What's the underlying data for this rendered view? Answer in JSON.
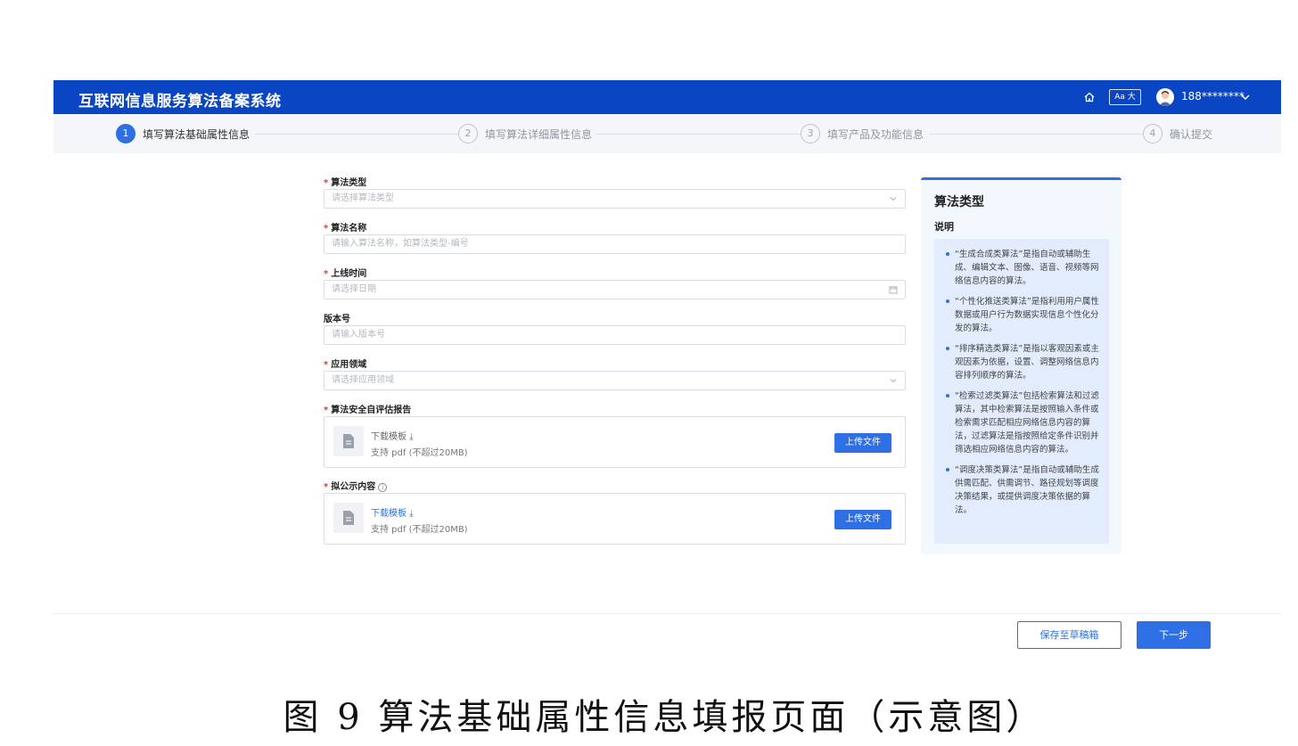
{
  "header": {
    "title": "互联网信息服务算法备案系统",
    "font_toggle": "Aa 大",
    "username": "188********",
    "icons": [
      "home-icon",
      "avatar",
      "chevron-down-icon"
    ]
  },
  "steps": [
    {
      "num": "1",
      "label": "填写算法基础属性信息",
      "active": true
    },
    {
      "num": "2",
      "label": "填写算法详细属性信息",
      "active": false
    },
    {
      "num": "3",
      "label": "填写产品及功能信息",
      "active": false
    },
    {
      "num": "4",
      "label": "确认提交",
      "active": false
    }
  ],
  "form": {
    "algo_type": {
      "label": "算法类型",
      "placeholder": "请选择算法类型"
    },
    "algo_name": {
      "label": "算法名称",
      "placeholder": "请输入算法名称，如算法类型-编号"
    },
    "launch_time": {
      "label": "上线时间",
      "placeholder": "请选择日期"
    },
    "version": {
      "label": "版本号",
      "placeholder": "请输入版本号"
    },
    "domain": {
      "label": "应用领域",
      "placeholder": "请选择应用领域"
    },
    "self_report": {
      "label": "算法安全自评估报告",
      "download": "下载模板",
      "support": "支持 pdf (不超过20MB)",
      "upload": "上传文件"
    },
    "public_content": {
      "label": "拟公示内容",
      "info": "i",
      "download": "下载模板",
      "support": "支持 pdf (不超过20MB)",
      "upload": "上传文件"
    }
  },
  "side_panel": {
    "title": "算法类型",
    "subtitle": "说明",
    "items": [
      "“生成合成类算法”是指自动或辅助生成、编辑文本、图像、语音、视频等网络信息内容的算法。",
      "“个性化推送类算法”是指利用用户属性数据或用户行为数据实现信息个性化分发的算法。",
      "“排序精选类算法”是指以客观因素或主观因素为依据，设置、调整网络信息内容排列顺序的算法。",
      "“检索过滤类算法”包括检索算法和过滤算法，其中检索算法是按照输入条件或检索需求匹配相应网络信息内容的算法，过滤算法是指按照给定条件识别并筛选相应网络信息内容的算法。",
      "“调度决策类算法”是指自动或辅助生成供需匹配、供需调节、路径规划等调度决策结果，或提供调度决策依据的算法。"
    ]
  },
  "footer": {
    "draft": "保存至草稿箱",
    "next": "下一步"
  },
  "caption": "图 9 算法基础属性信息填报页面（示意图）",
  "colors": {
    "brand": "#0a46c4",
    "accent": "#2f6fe6",
    "required": "#e23a2e"
  }
}
